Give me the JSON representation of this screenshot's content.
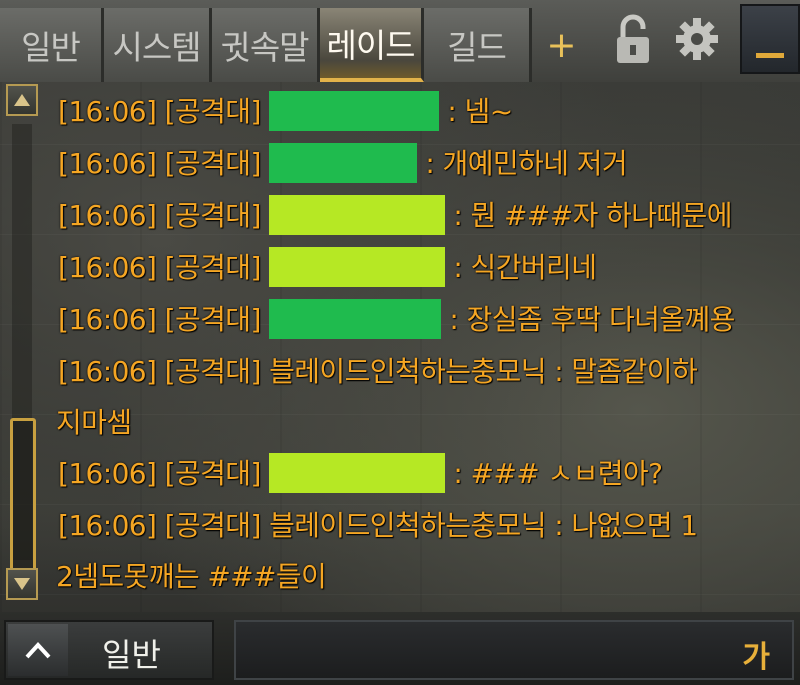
{
  "tabs": [
    "일반",
    "시스템",
    "귓속말",
    "레이드",
    "길드"
  ],
  "active_tab_index": 3,
  "tab_add_label": "+",
  "chat": {
    "text_color": "#f5a623",
    "redaction_colors": [
      "#1fbb4e",
      "#b6e824"
    ],
    "messages": [
      {
        "time": "[16:06]",
        "channel": "[공격대]",
        "sender": "",
        "redacted": true,
        "redact_color": "#1fbb4e",
        "text": ": 넴~"
      },
      {
        "time": "[16:06]",
        "channel": "[공격대]",
        "sender": "",
        "redacted": true,
        "redact_color": "#1fbb4e",
        "text": ": 개예민하네 저거"
      },
      {
        "time": "[16:06]",
        "channel": "[공격대]",
        "sender": "",
        "redacted": true,
        "redact_color": "#b6e824",
        "text": ": 뭔 ###자 하나때문에"
      },
      {
        "time": "[16:06]",
        "channel": "[공격대]",
        "sender": "",
        "redacted": true,
        "redact_color": "#b6e824",
        "text": ": 식간버리네"
      },
      {
        "time": "[16:06]",
        "channel": "[공격대]",
        "sender": "",
        "redacted": true,
        "redact_color": "#1fbb4e",
        "text": ": 장실좀 후딱 다녀올꼐용"
      },
      {
        "time": "[16:06]",
        "channel": "[공격대]",
        "sender": "블레이드인척하는충모닉",
        "redacted": false,
        "text": ": 말좀같이하",
        "text2": "지마셈"
      },
      {
        "time": "[16:06]",
        "channel": "[공격대]",
        "sender": "",
        "redacted": true,
        "redact_color": "#b6e824",
        "text": ": ### ㅅㅂ련아?"
      },
      {
        "time": "[16:06]",
        "channel": "[공격대]",
        "sender": "블레이드인척하는충모닉",
        "redacted": false,
        "text": ": 나없으면 1",
        "text2": "2넴도못깨는 ###들이"
      }
    ]
  },
  "bottom": {
    "channel_label": "일반",
    "ime_indicator": "가"
  },
  "icons": [
    "lock-open-icon",
    "gear-icon",
    "minimize-icon",
    "scroll-up-icon",
    "scroll-down-icon",
    "chevron-up-icon"
  ]
}
